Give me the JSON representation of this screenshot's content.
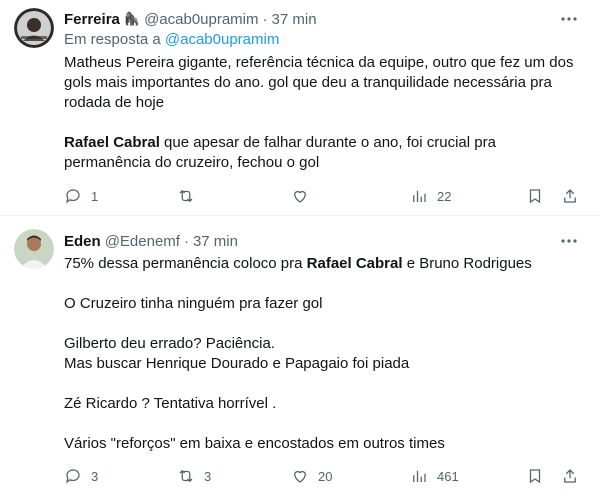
{
  "tweets": [
    {
      "name": "Ferreira",
      "emoji": "🦍",
      "handle": "@acab0upramim",
      "separator": "·",
      "time": "37 min",
      "reply_prefix": "Em resposta a",
      "reply_mention": "@acab0upramim",
      "body": {
        "p1_l1": "Matheus Pereira gigante, referência técnica da equipe, outro que fez um dos",
        "p1_l2": "gols mais importantes do ano. gol que deu a tranquilidade necessária pra",
        "p1_l3": "rodada de hoje",
        "p2_bold": "Rafael Cabral",
        "p2_l1_rest": " que apesar de falhar durante o ano, foi crucial pra",
        "p2_l2": "permanência do cruzeiro, fechou o gol"
      },
      "stats": {
        "replies": "1",
        "retweets": "",
        "likes": "",
        "views": "22"
      }
    },
    {
      "name": "Eden",
      "handle": "@Edenemf",
      "separator": "·",
      "time": "37 min",
      "body": {
        "l1_a": "75% dessa permanência coloco pra ",
        "l1_bold": "Rafael Cabral",
        "l1_b": " e Bruno Rodrigues",
        "l2": "O Cruzeiro tinha ninguém pra fazer gol",
        "l3": "Gilberto deu errado? Paciência.",
        "l4": "Mas buscar Henrique Dourado e Papagaio foi piada",
        "l5": "Zé Ricardo ? Tentativa horrível .",
        "l6": "Vários \"reforços\" em baixa e encostados em outros times"
      },
      "stats": {
        "replies": "3",
        "retweets": "3",
        "likes": "20",
        "views": "461"
      }
    }
  ],
  "colors": {
    "text": "#0f1419",
    "secondary": "#536471",
    "link": "#1d9bf0",
    "divider": "#eff3f4"
  },
  "icons": [
    "more-icon",
    "reply-icon",
    "retweet-icon",
    "like-icon",
    "views-icon",
    "bookmark-icon",
    "share-icon"
  ]
}
